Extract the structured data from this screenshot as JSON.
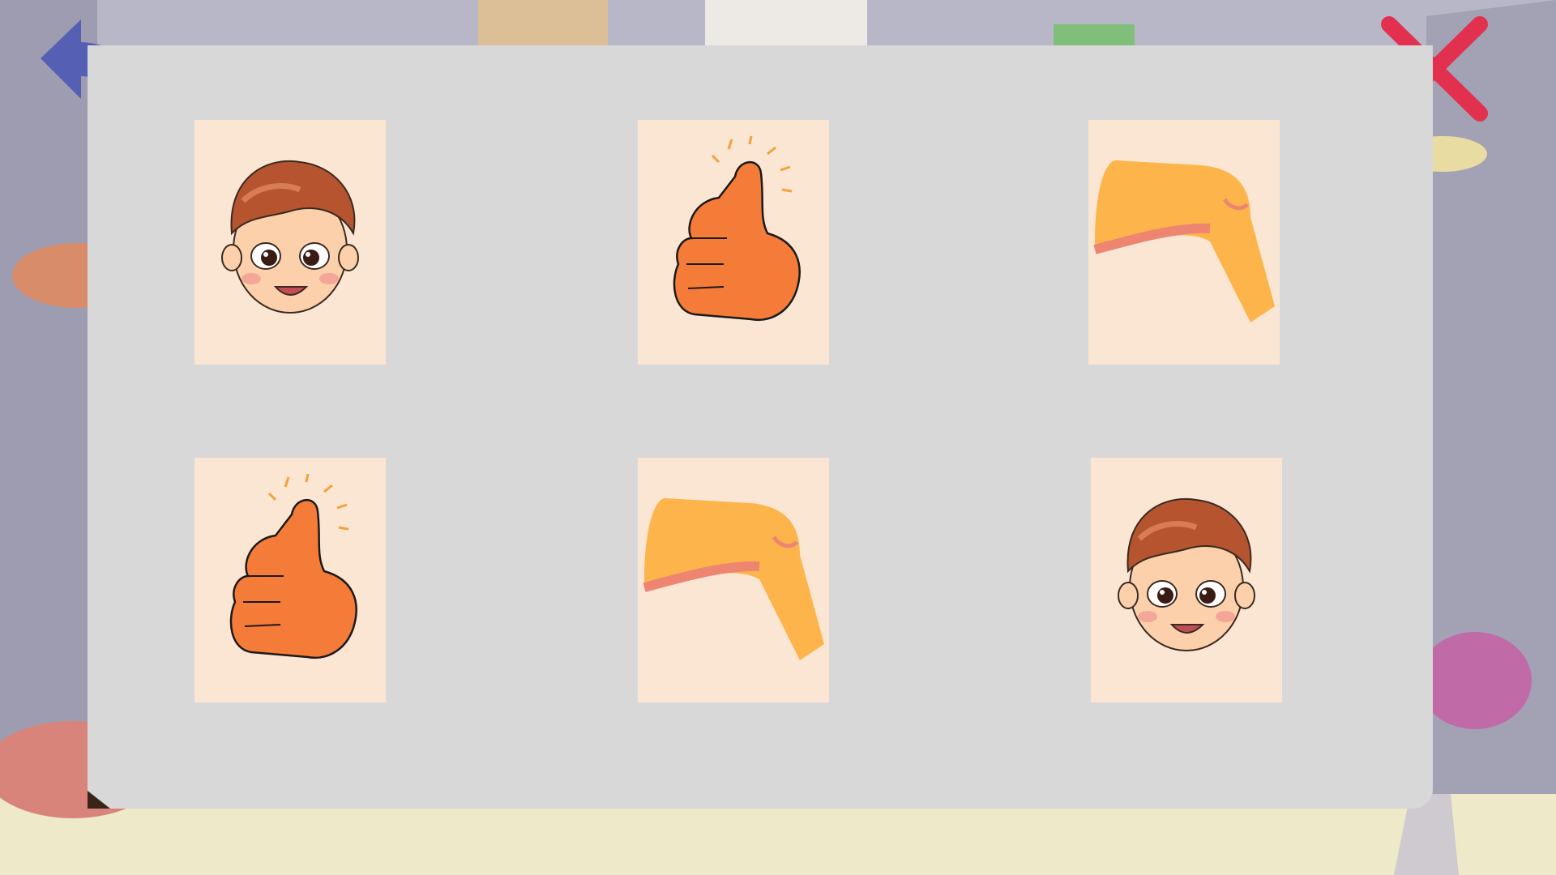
{
  "game": {
    "screen": "memory-card-grid",
    "colors": {
      "panel": "#d8d8d8",
      "card_face": "#fbe6d4",
      "back_arrow": "#5560b4",
      "close_x": "#e2304f",
      "skin": "#fbd0aa",
      "hair": "#b5542f",
      "thumb": "#f57b38",
      "knee": "#fdb54b",
      "knee_stripe": "#ee8570"
    }
  },
  "controls": {
    "back": {
      "icon": "back-arrow-icon"
    },
    "close": {
      "icon": "close-x-icon"
    }
  },
  "cards": [
    {
      "row": 1,
      "col": 1,
      "image": "boy-face"
    },
    {
      "row": 1,
      "col": 2,
      "image": "thumbs-up"
    },
    {
      "row": 1,
      "col": 3,
      "image": "knee"
    },
    {
      "row": 2,
      "col": 1,
      "image": "thumbs-up"
    },
    {
      "row": 2,
      "col": 2,
      "image": "knee"
    },
    {
      "row": 2,
      "col": 3,
      "image": "boy-face"
    }
  ]
}
